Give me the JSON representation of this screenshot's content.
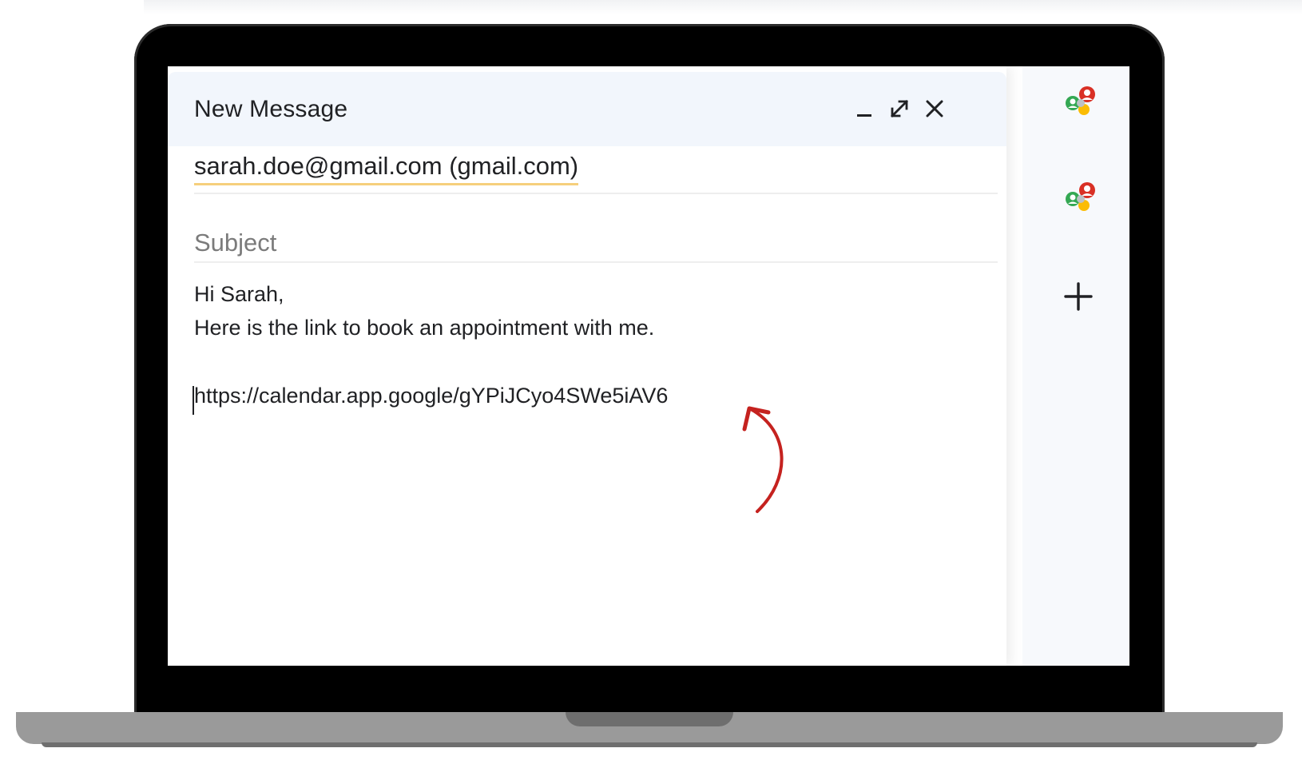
{
  "compose": {
    "title": "New Message",
    "recipient": "sarah.doe@gmail.com (gmail.com)",
    "subject_placeholder": "Subject",
    "subject_value": "",
    "body": {
      "greeting": "Hi Sarah,",
      "line1": "Here is the link to book an appointment with me.",
      "link": "https://calendar.app.google/gYPiJCyo4SWe5iAV6"
    },
    "header_icons": [
      "minimize-icon",
      "expand-icon",
      "close-icon"
    ]
  },
  "side_panel": {
    "icons": [
      "contacts-icon",
      "contacts-icon",
      "plus-icon"
    ]
  },
  "colors": {
    "header_bg": "#f2f6fc",
    "recipient_underline": "#f6cf7c",
    "annotation_arrow": "#c5221f",
    "laptop_frame": "#000000",
    "laptop_base": "#9a9a9a"
  }
}
